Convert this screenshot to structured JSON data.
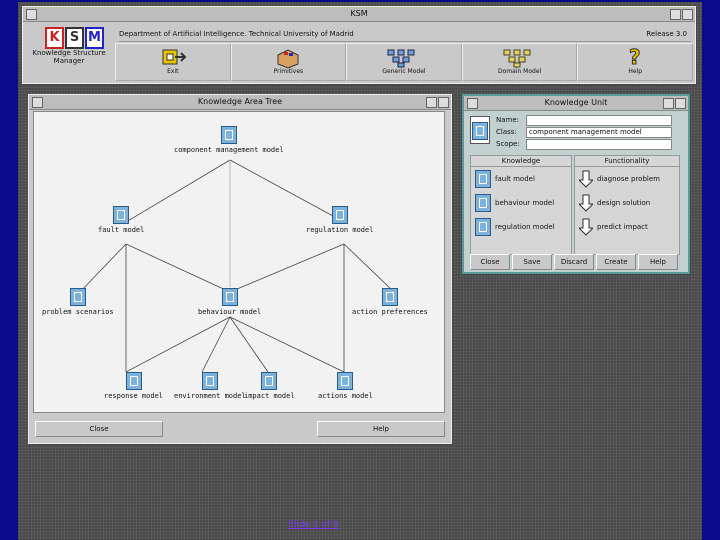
{
  "app": {
    "window_title": "KSM",
    "department": "Department of Artificial Intelligence. Technical University of Madrid",
    "release": "Release 3.0",
    "logo_letters": [
      "K",
      "S",
      "M"
    ],
    "logo_text": "Knowledge Structure Manager"
  },
  "toolbar": {
    "items": [
      {
        "label": "Exit",
        "icon": "exit-icon"
      },
      {
        "label": "Primitives",
        "icon": "primitives-icon"
      },
      {
        "label": "Generic Model",
        "icon": "generic-model-icon"
      },
      {
        "label": "Domain Model",
        "icon": "domain-model-icon"
      },
      {
        "label": "Help",
        "icon": "help-icon"
      }
    ]
  },
  "tree": {
    "title": "Knowledge Area Tree",
    "nodes": {
      "root": "component management model",
      "fault": "fault model",
      "regulation": "regulation model",
      "problem": "problem scenarios",
      "behaviour": "behaviour model",
      "action_pref": "action preferences",
      "response": "response model",
      "environment": "environment model",
      "impact": "impact model",
      "actions": "actions model"
    },
    "buttons": {
      "close": "Close",
      "help": "Help"
    }
  },
  "kwin": {
    "title": "Knowledge Unit",
    "fields": {
      "name_label": "Name:",
      "class_label": "Class:",
      "class_value": "component management model",
      "scope_label": "Scope:"
    },
    "knowledge_header": "Knowledge",
    "functionality_header": "Functionality",
    "knowledge": [
      "fault model",
      "behaviour model",
      "regulation model"
    ],
    "functionality": [
      "diagnose problem",
      "design solution",
      "predict impact"
    ],
    "buttons": [
      "Close",
      "Save",
      "Discard",
      "Create",
      "Help"
    ]
  },
  "footer": "Slide 1 of 9"
}
